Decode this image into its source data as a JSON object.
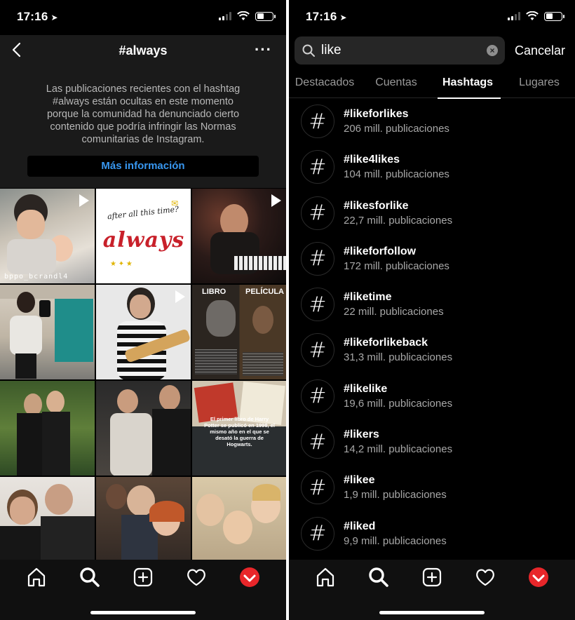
{
  "status": {
    "time": "17:16"
  },
  "left": {
    "header": {
      "title": "#always"
    },
    "notice": {
      "line1": "Las publicaciones recientes con el hashtag",
      "line2": "#always están ocultas en este momento",
      "line3": "porque la comunidad ha denunciado cierto",
      "line4": "contenido que podría infringir las Normas",
      "line5": "comunitarias de Instagram.",
      "button": "Más información"
    },
    "grid": {
      "c1_caption": "bppo_bcrandl4",
      "c2_text_top": "after all this time?",
      "c2_text_main": "always",
      "c6_left": "LIBRO",
      "c6_right": "PELÍCULA",
      "c9_line1": "El primer libro de Harry",
      "c9_line2": "Potter se publicó en 1998, el",
      "c9_line3": "mismo año en el que se",
      "c9_line4": "desató la guerra de",
      "c9_line5": "Hogwarts."
    }
  },
  "right": {
    "search": {
      "value": "like",
      "cancel": "Cancelar"
    },
    "tabs": [
      "Destacados",
      "Cuentas",
      "Hashtags",
      "Lugares"
    ],
    "results": [
      {
        "name": "#likeforlikes",
        "count": "206 mill. publicaciones"
      },
      {
        "name": "#like4likes",
        "count": "104 mill. publicaciones"
      },
      {
        "name": "#likesforlike",
        "count": "22,7 mill. publicaciones"
      },
      {
        "name": "#likeforfollow",
        "count": "172 mill. publicaciones"
      },
      {
        "name": "#liketime",
        "count": "22 mill. publicaciones"
      },
      {
        "name": "#likeforlikeback",
        "count": "31,3 mill. publicaciones"
      },
      {
        "name": "#likelike",
        "count": "19,6 mill. publicaciones"
      },
      {
        "name": "#likers",
        "count": "14,2 mill. publicaciones"
      },
      {
        "name": "#likee",
        "count": "1,9 mill. publicaciones"
      },
      {
        "name": "#liked",
        "count": "9,9 mill. publicaciones"
      }
    ]
  },
  "colors": {
    "link": "#3897f0",
    "accent": "#e8262a"
  },
  "icons": [
    "home-icon",
    "search-icon",
    "add-post-icon",
    "heart-icon",
    "profile-avatar"
  ]
}
